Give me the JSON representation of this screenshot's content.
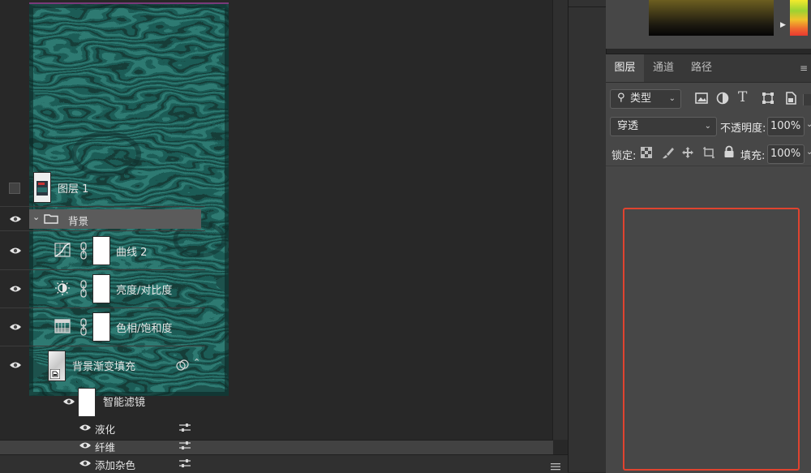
{
  "layers_panel": {
    "tabs": [
      {
        "label": "图层",
        "active": true
      },
      {
        "label": "通道",
        "active": false
      },
      {
        "label": "路径",
        "active": false
      }
    ],
    "filter": {
      "kind_label": "类型"
    },
    "blend_mode": "穿透",
    "opacity_label": "不透明度:",
    "opacity_value": "100%",
    "lock_label": "锁定:",
    "fill_label": "填充:",
    "fill_value": "100%",
    "layers": {
      "layer1": {
        "name": "图层 1",
        "visible": false
      },
      "group_background": {
        "name": "背景",
        "expanded": true,
        "visible": true
      },
      "curves": {
        "name": "曲线 2",
        "visible": true
      },
      "brightness": {
        "name": "亮度/对比度",
        "visible": true
      },
      "hue_sat": {
        "name": "色相/饱和度",
        "visible": true
      },
      "gradient_fill": {
        "name": "背景渐变填充",
        "visible": true
      },
      "smart_filters": {
        "name": "智能滤镜",
        "visible": true
      },
      "filters": [
        {
          "name": "液化",
          "visible": true
        },
        {
          "name": "纤维",
          "visible": true
        },
        {
          "name": "添加杂色",
          "visible": true
        }
      ]
    }
  },
  "colors": {
    "canvas_bg": "#282828",
    "panel_bg": "#474747",
    "document_teal": "#1f5a55",
    "highlight_frame": "#e0432f"
  }
}
